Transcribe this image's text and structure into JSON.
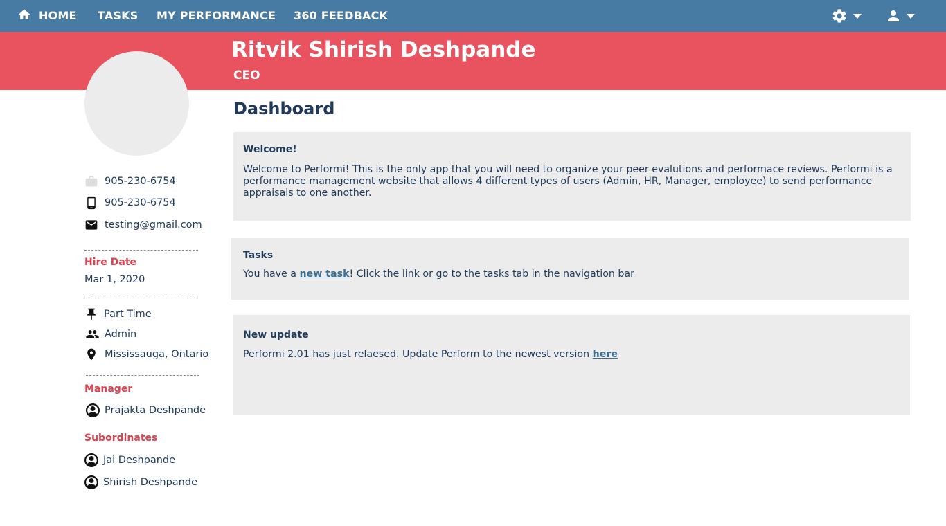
{
  "nav": {
    "items": [
      {
        "label": "HOME",
        "icon": "home-icon"
      },
      {
        "label": "TASKS"
      },
      {
        "label": "MY PERFORMANCE"
      },
      {
        "label": "360 FEEDBACK"
      }
    ],
    "right_icons": [
      "gear-icon",
      "user-icon"
    ]
  },
  "profile": {
    "name": "Ritvik Shirish Deshpande",
    "role": "CEO",
    "work_phone": "905-230-6754",
    "mobile_phone": "905-230-6754",
    "email": "testing@gmail.com",
    "hire_date_label": "Hire Date",
    "hire_date": "Mar 1, 2020",
    "employment_type": "Part Time",
    "user_role": "Admin",
    "location": "Mississauga, Ontario",
    "manager_label": "Manager",
    "manager": "Prajakta Deshpande",
    "subordinates_label": "Subordinates",
    "subordinates": [
      "Jai Deshpande",
      "Shirish Deshpande"
    ]
  },
  "dashboard": {
    "title": "Dashboard",
    "welcome": {
      "title": "Welcome!",
      "body": "Welcome to Performi! This is the only app that you will need to organize your peer evalutions and performace reviews. Performi is a performance management website that allows 4 different types of users (Admin, HR, Manager, employee) to send performance appraisals to one another."
    },
    "tasks": {
      "title": "Tasks",
      "prefix": "You have a ",
      "link": "new task",
      "suffix": "! Click the link or go to the tasks tab in the navigation bar"
    },
    "update": {
      "title": "New update",
      "prefix": "Performi 2.01 has just relaesed. Update Perform to the newest version ",
      "link": "here"
    }
  },
  "colors": {
    "nav": "#477ba3",
    "banner": "#e8535f",
    "accent_heading": "#e0414f",
    "card": "#ececec",
    "text": "#1f3a5a"
  }
}
